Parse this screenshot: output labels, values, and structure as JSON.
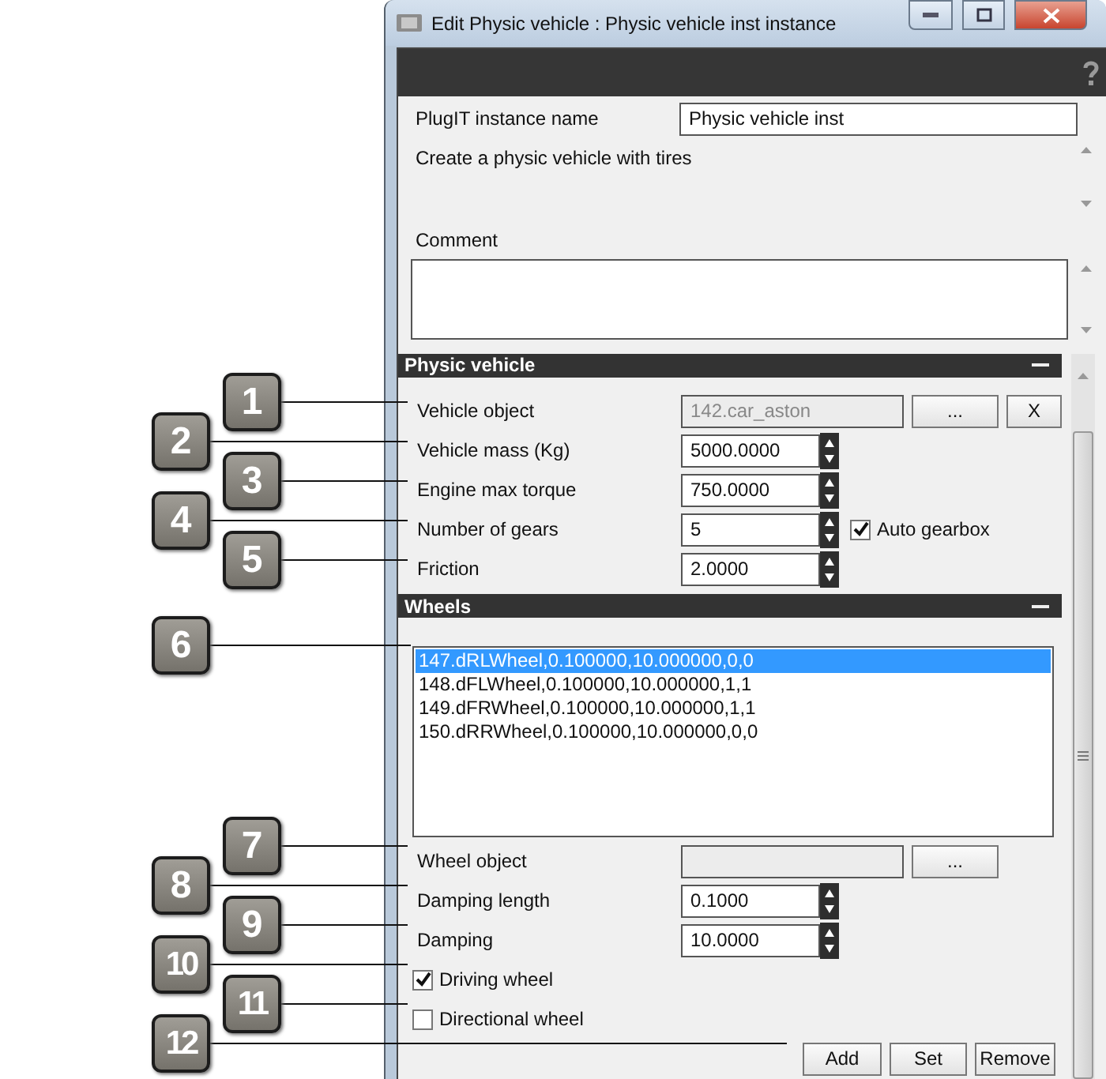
{
  "window": {
    "title": "Edit Physic vehicle : Physic vehicle inst instance"
  },
  "instance_name": {
    "label": "PlugIT instance name",
    "value": "Physic vehicle inst"
  },
  "description": "Create a physic vehicle with tires",
  "comment": {
    "label": "Comment"
  },
  "physic_vehicle": {
    "title": "Physic vehicle",
    "fields": [
      {
        "kind": "object",
        "label": "Vehicle object",
        "value": "142.car_aston",
        "disabled": true,
        "buttons": [
          "...",
          "X"
        ]
      },
      {
        "kind": "spin",
        "label": "Vehicle mass (Kg)",
        "value": "5000.0000"
      },
      {
        "kind": "spin",
        "label": "Engine max torque",
        "value": "750.0000"
      },
      {
        "kind": "spin",
        "label": "Number of gears",
        "value": "5",
        "checkbox": {
          "label": "Auto gearbox",
          "checked": true
        }
      },
      {
        "kind": "spin",
        "label": "Friction",
        "value": "2.0000"
      }
    ]
  },
  "wheels": {
    "title": "Wheels",
    "list": [
      {
        "text": "147.dRLWheel,0.100000,10.000000,0,0",
        "selected": true
      },
      {
        "text": "148.dFLWheel,0.100000,10.000000,1,1",
        "selected": false
      },
      {
        "text": "149.dFRWheel,0.100000,10.000000,1,1",
        "selected": false
      },
      {
        "text": "150.dRRWheel,0.100000,10.000000,0,0",
        "selected": false
      }
    ],
    "fields": [
      {
        "kind": "object",
        "label": "Wheel object",
        "disabled": true,
        "buttons": [
          "..."
        ]
      },
      {
        "kind": "spin",
        "label": "Damping length",
        "value": "0.1000"
      },
      {
        "kind": "spin",
        "label": "Damping",
        "value": "10.0000"
      },
      {
        "kind": "check",
        "label": "Driving wheel",
        "checked": true
      },
      {
        "kind": "check",
        "label": "Directional wheel",
        "checked": false
      }
    ],
    "buttons": [
      "Add",
      "Set",
      "Remove"
    ]
  },
  "callouts": [
    {
      "number": "1"
    },
    {
      "number": "2"
    },
    {
      "number": "3"
    },
    {
      "number": "4"
    },
    {
      "number": "5"
    },
    {
      "number": "6"
    },
    {
      "number": "7"
    },
    {
      "number": "8"
    },
    {
      "number": "9"
    },
    {
      "number": "10"
    },
    {
      "number": "11"
    },
    {
      "number": "12"
    }
  ]
}
